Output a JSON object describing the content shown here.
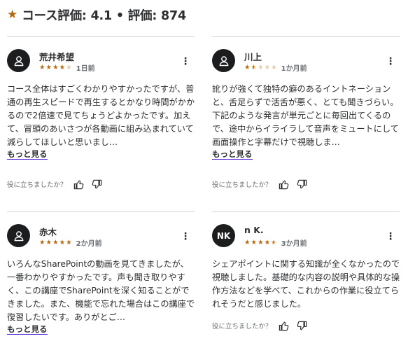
{
  "header": {
    "star_icon": "star-icon",
    "title": "コース評価: 4.1 • 評価: 874"
  },
  "reviews": [
    {
      "name": "荒井希望",
      "avatar_icon": "person-icon",
      "rating": 4,
      "time": "1日前",
      "text": "コース全体はすごくわかりやすかったですが、普通の再生スピードで再生するとかなり時間がかかるので2倍速で見てちょうどよかったです。加えて、冒頭のあいさつが各動画に組み込まれていて減らしてほしいと思いまし…",
      "more": "もっと見る",
      "helpful": "役に立ちましたか？"
    },
    {
      "name": "川上",
      "avatar_icon": "person-icon",
      "rating": 1.5,
      "time": "1か月前",
      "text": "訛りが強くて独特の癖のあるイントネーションと、舌足らずで活舌が悪く、とても聞きづらい。下記のような発言が単元ごとに毎回出てくるので、途中からイライラして音声をミュートにして画面操作と字幕だけで視聴しま…",
      "more": "もっと見る",
      "helpful": "役に立ちましたか？"
    },
    {
      "name": "赤木",
      "avatar_icon": "person-icon",
      "rating": 5,
      "time": "2か月前",
      "text": "いろんなSharePointの動画を見てきましたが、一番わかりやすかったです。声も聞き取りやすく、この講座でSharePointを深く知ることができました。また、機能で忘れた場合はこの講座で復習したいです。ありがとご…",
      "more": "もっと見る",
      "helpful": "役に立ちましたか？"
    },
    {
      "name": "n K.",
      "avatar_initials": "NK",
      "rating": 4.5,
      "time": "3か月前",
      "text": "シェアポイントに関する知識が全くなかったので視聴しました。基礎的な内容の説明や具体的な操作方法などを学べて、これからの作業に役立てられそうだと感じました。",
      "helpful": "役に立ちましたか？"
    }
  ],
  "colors": {
    "star": "#b4690e",
    "text": "#2d2f31",
    "muted": "#6a6f73",
    "link_underline": "#5624d0",
    "divider": "#d1d7dc",
    "avatar_bg": "#1c1d1f"
  }
}
